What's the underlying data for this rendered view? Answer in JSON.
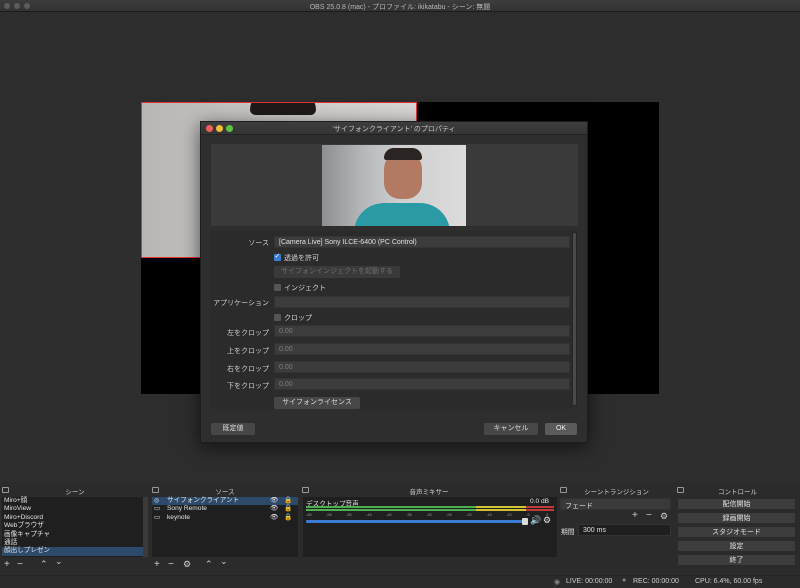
{
  "window": {
    "title": "OBS 25.0.8 (mac) - プロファイル: ikikatabu - シーン: 無題"
  },
  "dialog": {
    "title": "'サイフォンクライアント' のプロパティ",
    "source_label": "ソース",
    "source_value": "[Camera Live] Sony ILCE-6400 (PC Control)",
    "allow_transparency_label": "透過を許可",
    "allow_transparency_checked": true,
    "launch_inject_button": "サイフォンインジェクトを起動する",
    "inject_label": "インジェクト",
    "inject_checked": false,
    "application_label": "アプリケーション",
    "application_value": "",
    "crop_label": "クロップ",
    "crop_checked": false,
    "crop_left_label": "左をクロップ",
    "crop_left_value": "0.00",
    "crop_top_label": "上をクロップ",
    "crop_top_value": "0.00",
    "crop_right_label": "右をクロップ",
    "crop_right_value": "0.00",
    "crop_bottom_label": "下をクロップ",
    "crop_bottom_value": "0.00",
    "license_button": "サイフォンライセンス",
    "defaults_button": "既定値",
    "cancel_button": "キャンセル",
    "ok_button": "OK"
  },
  "scenes": {
    "header": "シーン",
    "items": [
      "Miro+顔",
      "MiroView",
      "Miro+Discord",
      "Webブラウザ",
      "画像キャプチャ",
      "通話",
      "顔出しプレゼン"
    ],
    "selected_index": 6
  },
  "sources": {
    "header": "ソース",
    "items": [
      "サイフォンクライアント",
      "Sony Remote",
      "keynote"
    ],
    "selected_index": 0
  },
  "mixer": {
    "header": "音声ミキサー",
    "track_name": "デスクトップ音声",
    "level": "0.0 dB",
    "scale": [
      "-60",
      "-55",
      "-50",
      "-45",
      "-40",
      "-35",
      "-30",
      "-25",
      "-20",
      "-15",
      "-10",
      "-5",
      "0"
    ],
    "volume_fraction": 1.0
  },
  "transitions": {
    "header": "シーントランジション",
    "selected": "フェード",
    "duration_label": "期間",
    "duration_value": "300 ms"
  },
  "controls": {
    "header": "コントロール",
    "buttons": [
      "配信開始",
      "録画開始",
      "スタジオモード",
      "設定",
      "終了"
    ]
  },
  "status": {
    "live": "LIVE: 00:00:00",
    "rec": "REC: 00:00:00",
    "cpu": "CPU: 6.4%, 60.00 fps"
  },
  "colors": {
    "accent": "#3b7bd4",
    "selection_border": "#e03030",
    "meter_green": "#4caf50",
    "meter_yellow": "#d4c235",
    "meter_red": "#c03a3a"
  }
}
